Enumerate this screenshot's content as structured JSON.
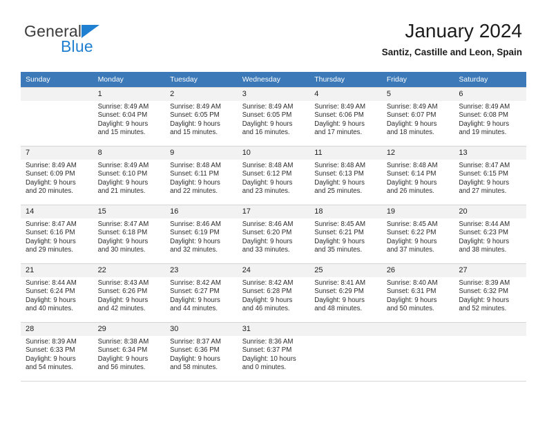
{
  "brand": {
    "name_part1": "General",
    "name_part2": "Blue",
    "triangle_icon": "triangle-icon"
  },
  "header": {
    "title": "January 2024",
    "location": "Santiz, Castille and Leon, Spain"
  },
  "colors": {
    "header_blue": "#3b79b8",
    "brand_blue": "#1f7fd0",
    "daynum_background": "#f2f2f2",
    "row_border": "#d5d5d5"
  },
  "weekday_headers": [
    "Sunday",
    "Monday",
    "Tuesday",
    "Wednesday",
    "Thursday",
    "Friday",
    "Saturday"
  ],
  "weeks": [
    [
      {
        "day": "",
        "sunrise": "",
        "sunset": "",
        "daylight_line1": "",
        "daylight_line2": "",
        "empty": true
      },
      {
        "day": "1",
        "sunrise": "Sunrise: 8:49 AM",
        "sunset": "Sunset: 6:04 PM",
        "daylight_line1": "Daylight: 9 hours",
        "daylight_line2": "and 15 minutes."
      },
      {
        "day": "2",
        "sunrise": "Sunrise: 8:49 AM",
        "sunset": "Sunset: 6:05 PM",
        "daylight_line1": "Daylight: 9 hours",
        "daylight_line2": "and 15 minutes."
      },
      {
        "day": "3",
        "sunrise": "Sunrise: 8:49 AM",
        "sunset": "Sunset: 6:05 PM",
        "daylight_line1": "Daylight: 9 hours",
        "daylight_line2": "and 16 minutes."
      },
      {
        "day": "4",
        "sunrise": "Sunrise: 8:49 AM",
        "sunset": "Sunset: 6:06 PM",
        "daylight_line1": "Daylight: 9 hours",
        "daylight_line2": "and 17 minutes."
      },
      {
        "day": "5",
        "sunrise": "Sunrise: 8:49 AM",
        "sunset": "Sunset: 6:07 PM",
        "daylight_line1": "Daylight: 9 hours",
        "daylight_line2": "and 18 minutes."
      },
      {
        "day": "6",
        "sunrise": "Sunrise: 8:49 AM",
        "sunset": "Sunset: 6:08 PM",
        "daylight_line1": "Daylight: 9 hours",
        "daylight_line2": "and 19 minutes."
      }
    ],
    [
      {
        "day": "7",
        "sunrise": "Sunrise: 8:49 AM",
        "sunset": "Sunset: 6:09 PM",
        "daylight_line1": "Daylight: 9 hours",
        "daylight_line2": "and 20 minutes."
      },
      {
        "day": "8",
        "sunrise": "Sunrise: 8:49 AM",
        "sunset": "Sunset: 6:10 PM",
        "daylight_line1": "Daylight: 9 hours",
        "daylight_line2": "and 21 minutes."
      },
      {
        "day": "9",
        "sunrise": "Sunrise: 8:48 AM",
        "sunset": "Sunset: 6:11 PM",
        "daylight_line1": "Daylight: 9 hours",
        "daylight_line2": "and 22 minutes."
      },
      {
        "day": "10",
        "sunrise": "Sunrise: 8:48 AM",
        "sunset": "Sunset: 6:12 PM",
        "daylight_line1": "Daylight: 9 hours",
        "daylight_line2": "and 23 minutes."
      },
      {
        "day": "11",
        "sunrise": "Sunrise: 8:48 AM",
        "sunset": "Sunset: 6:13 PM",
        "daylight_line1": "Daylight: 9 hours",
        "daylight_line2": "and 25 minutes."
      },
      {
        "day": "12",
        "sunrise": "Sunrise: 8:48 AM",
        "sunset": "Sunset: 6:14 PM",
        "daylight_line1": "Daylight: 9 hours",
        "daylight_line2": "and 26 minutes."
      },
      {
        "day": "13",
        "sunrise": "Sunrise: 8:47 AM",
        "sunset": "Sunset: 6:15 PM",
        "daylight_line1": "Daylight: 9 hours",
        "daylight_line2": "and 27 minutes."
      }
    ],
    [
      {
        "day": "14",
        "sunrise": "Sunrise: 8:47 AM",
        "sunset": "Sunset: 6:16 PM",
        "daylight_line1": "Daylight: 9 hours",
        "daylight_line2": "and 29 minutes."
      },
      {
        "day": "15",
        "sunrise": "Sunrise: 8:47 AM",
        "sunset": "Sunset: 6:18 PM",
        "daylight_line1": "Daylight: 9 hours",
        "daylight_line2": "and 30 minutes."
      },
      {
        "day": "16",
        "sunrise": "Sunrise: 8:46 AM",
        "sunset": "Sunset: 6:19 PM",
        "daylight_line1": "Daylight: 9 hours",
        "daylight_line2": "and 32 minutes."
      },
      {
        "day": "17",
        "sunrise": "Sunrise: 8:46 AM",
        "sunset": "Sunset: 6:20 PM",
        "daylight_line1": "Daylight: 9 hours",
        "daylight_line2": "and 33 minutes."
      },
      {
        "day": "18",
        "sunrise": "Sunrise: 8:45 AM",
        "sunset": "Sunset: 6:21 PM",
        "daylight_line1": "Daylight: 9 hours",
        "daylight_line2": "and 35 minutes."
      },
      {
        "day": "19",
        "sunrise": "Sunrise: 8:45 AM",
        "sunset": "Sunset: 6:22 PM",
        "daylight_line1": "Daylight: 9 hours",
        "daylight_line2": "and 37 minutes."
      },
      {
        "day": "20",
        "sunrise": "Sunrise: 8:44 AM",
        "sunset": "Sunset: 6:23 PM",
        "daylight_line1": "Daylight: 9 hours",
        "daylight_line2": "and 38 minutes."
      }
    ],
    [
      {
        "day": "21",
        "sunrise": "Sunrise: 8:44 AM",
        "sunset": "Sunset: 6:24 PM",
        "daylight_line1": "Daylight: 9 hours",
        "daylight_line2": "and 40 minutes."
      },
      {
        "day": "22",
        "sunrise": "Sunrise: 8:43 AM",
        "sunset": "Sunset: 6:26 PM",
        "daylight_line1": "Daylight: 9 hours",
        "daylight_line2": "and 42 minutes."
      },
      {
        "day": "23",
        "sunrise": "Sunrise: 8:42 AM",
        "sunset": "Sunset: 6:27 PM",
        "daylight_line1": "Daylight: 9 hours",
        "daylight_line2": "and 44 minutes."
      },
      {
        "day": "24",
        "sunrise": "Sunrise: 8:42 AM",
        "sunset": "Sunset: 6:28 PM",
        "daylight_line1": "Daylight: 9 hours",
        "daylight_line2": "and 46 minutes."
      },
      {
        "day": "25",
        "sunrise": "Sunrise: 8:41 AM",
        "sunset": "Sunset: 6:29 PM",
        "daylight_line1": "Daylight: 9 hours",
        "daylight_line2": "and 48 minutes."
      },
      {
        "day": "26",
        "sunrise": "Sunrise: 8:40 AM",
        "sunset": "Sunset: 6:31 PM",
        "daylight_line1": "Daylight: 9 hours",
        "daylight_line2": "and 50 minutes."
      },
      {
        "day": "27",
        "sunrise": "Sunrise: 8:39 AM",
        "sunset": "Sunset: 6:32 PM",
        "daylight_line1": "Daylight: 9 hours",
        "daylight_line2": "and 52 minutes."
      }
    ],
    [
      {
        "day": "28",
        "sunrise": "Sunrise: 8:39 AM",
        "sunset": "Sunset: 6:33 PM",
        "daylight_line1": "Daylight: 9 hours",
        "daylight_line2": "and 54 minutes."
      },
      {
        "day": "29",
        "sunrise": "Sunrise: 8:38 AM",
        "sunset": "Sunset: 6:34 PM",
        "daylight_line1": "Daylight: 9 hours",
        "daylight_line2": "and 56 minutes."
      },
      {
        "day": "30",
        "sunrise": "Sunrise: 8:37 AM",
        "sunset": "Sunset: 6:36 PM",
        "daylight_line1": "Daylight: 9 hours",
        "daylight_line2": "and 58 minutes."
      },
      {
        "day": "31",
        "sunrise": "Sunrise: 8:36 AM",
        "sunset": "Sunset: 6:37 PM",
        "daylight_line1": "Daylight: 10 hours",
        "daylight_line2": "and 0 minutes."
      },
      {
        "day": "",
        "sunrise": "",
        "sunset": "",
        "daylight_line1": "",
        "daylight_line2": "",
        "empty": true
      },
      {
        "day": "",
        "sunrise": "",
        "sunset": "",
        "daylight_line1": "",
        "daylight_line2": "",
        "empty": true
      },
      {
        "day": "",
        "sunrise": "",
        "sunset": "",
        "daylight_line1": "",
        "daylight_line2": "",
        "empty": true
      }
    ]
  ]
}
